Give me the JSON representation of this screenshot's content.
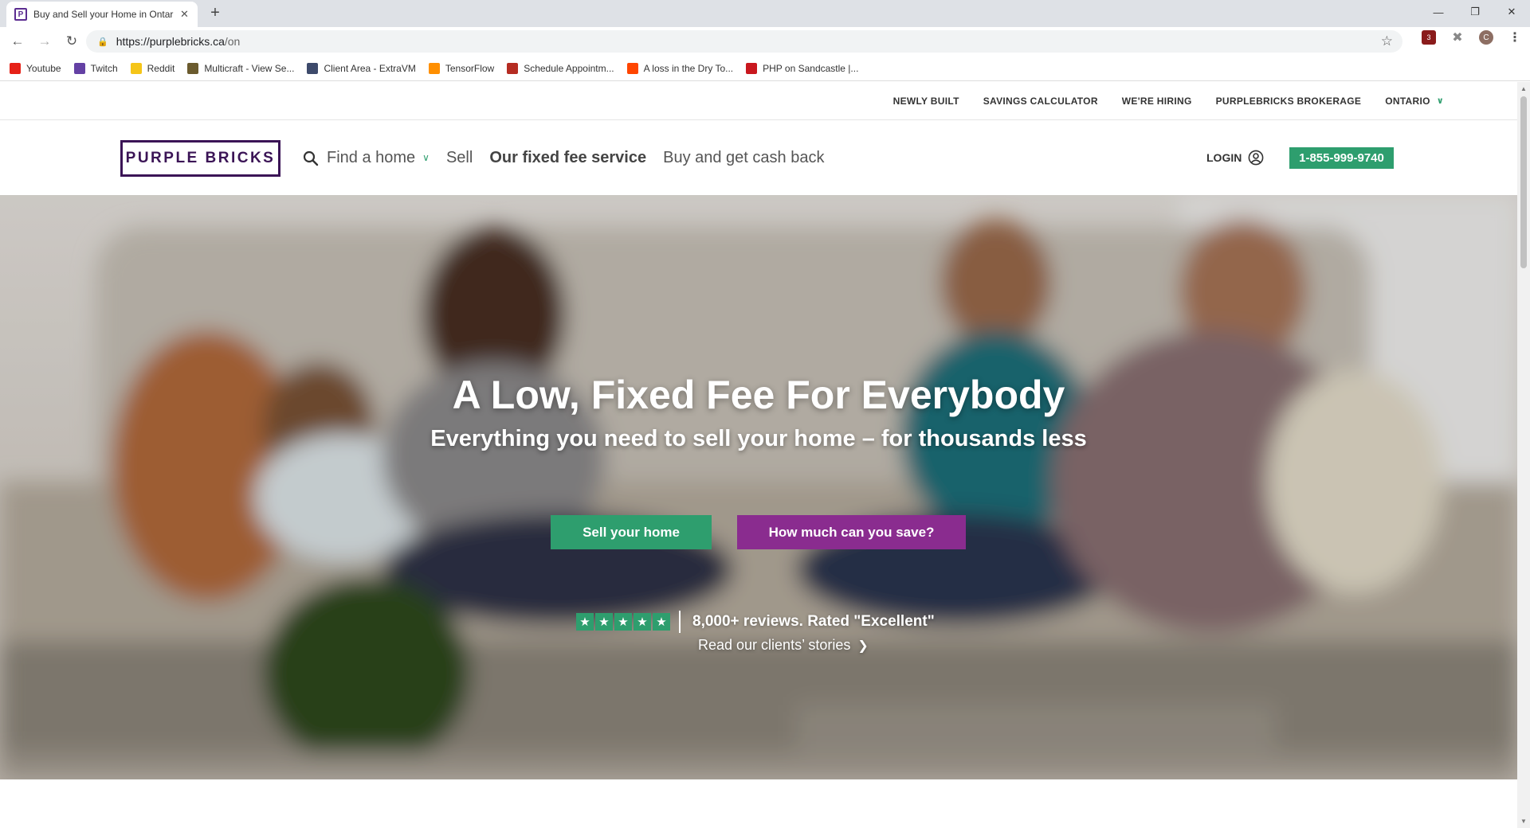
{
  "browser": {
    "tab_title": "Buy and Sell your Home in Ontar",
    "tab_favicon": "P",
    "url_host": "https://purplebricks.ca",
    "url_path": "/on",
    "avatar_letter": "C",
    "bookmarks": [
      {
        "label": "Youtube",
        "color": "#e62117",
        "icon": "youtube-icon"
      },
      {
        "label": "Twitch",
        "color": "#6441a4",
        "icon": "twitch-icon"
      },
      {
        "label": "Reddit",
        "color": "#f5c518",
        "icon": "folder-icon"
      },
      {
        "label": "Multicraft - View Se...",
        "color": "#6b5b2e",
        "icon": "multicraft-icon"
      },
      {
        "label": "Client Area - ExtraVM",
        "color": "#3d4a6b",
        "icon": "extravm-icon"
      },
      {
        "label": "TensorFlow",
        "color": "#ff8f00",
        "icon": "tensorflow-icon"
      },
      {
        "label": "Schedule Appointm...",
        "color": "#b52c22",
        "icon": "schedule-icon"
      },
      {
        "label": "A loss in the Dry To...",
        "color": "#ff4500",
        "icon": "reddit-icon"
      },
      {
        "label": "PHP on Sandcastle |...",
        "color": "#c9171e",
        "icon": "b-icon"
      }
    ]
  },
  "utility_nav": {
    "links": [
      "NEWLY BUILT",
      "SAVINGS CALCULATOR",
      "WE'RE HIRING",
      "PURPLEBRICKS BROKERAGE"
    ],
    "region": "ONTARIO"
  },
  "header": {
    "logo_text": "PURPLE BRICKS",
    "nav": {
      "find_home": "Find a home",
      "sell": "Sell",
      "fixed_fee": "Our fixed fee service",
      "cash_back": "Buy and get cash back"
    },
    "login": "LOGIN",
    "phone": "1-855-999-9740"
  },
  "hero": {
    "title": "A Low, Fixed Fee For Everybody",
    "subtitle": "Everything you need to sell your home – for thousands less",
    "sell_button": "Sell your home",
    "save_button": "How much can you save?",
    "reviews": "8,000+ reviews. Rated \"Excellent\"",
    "stories_link": "Read our clients’ stories",
    "star_count": 5
  },
  "colors": {
    "brand_purple": "#3b1456",
    "accent_green": "#2e9e6e",
    "cta_purple": "#8a2c8f"
  }
}
